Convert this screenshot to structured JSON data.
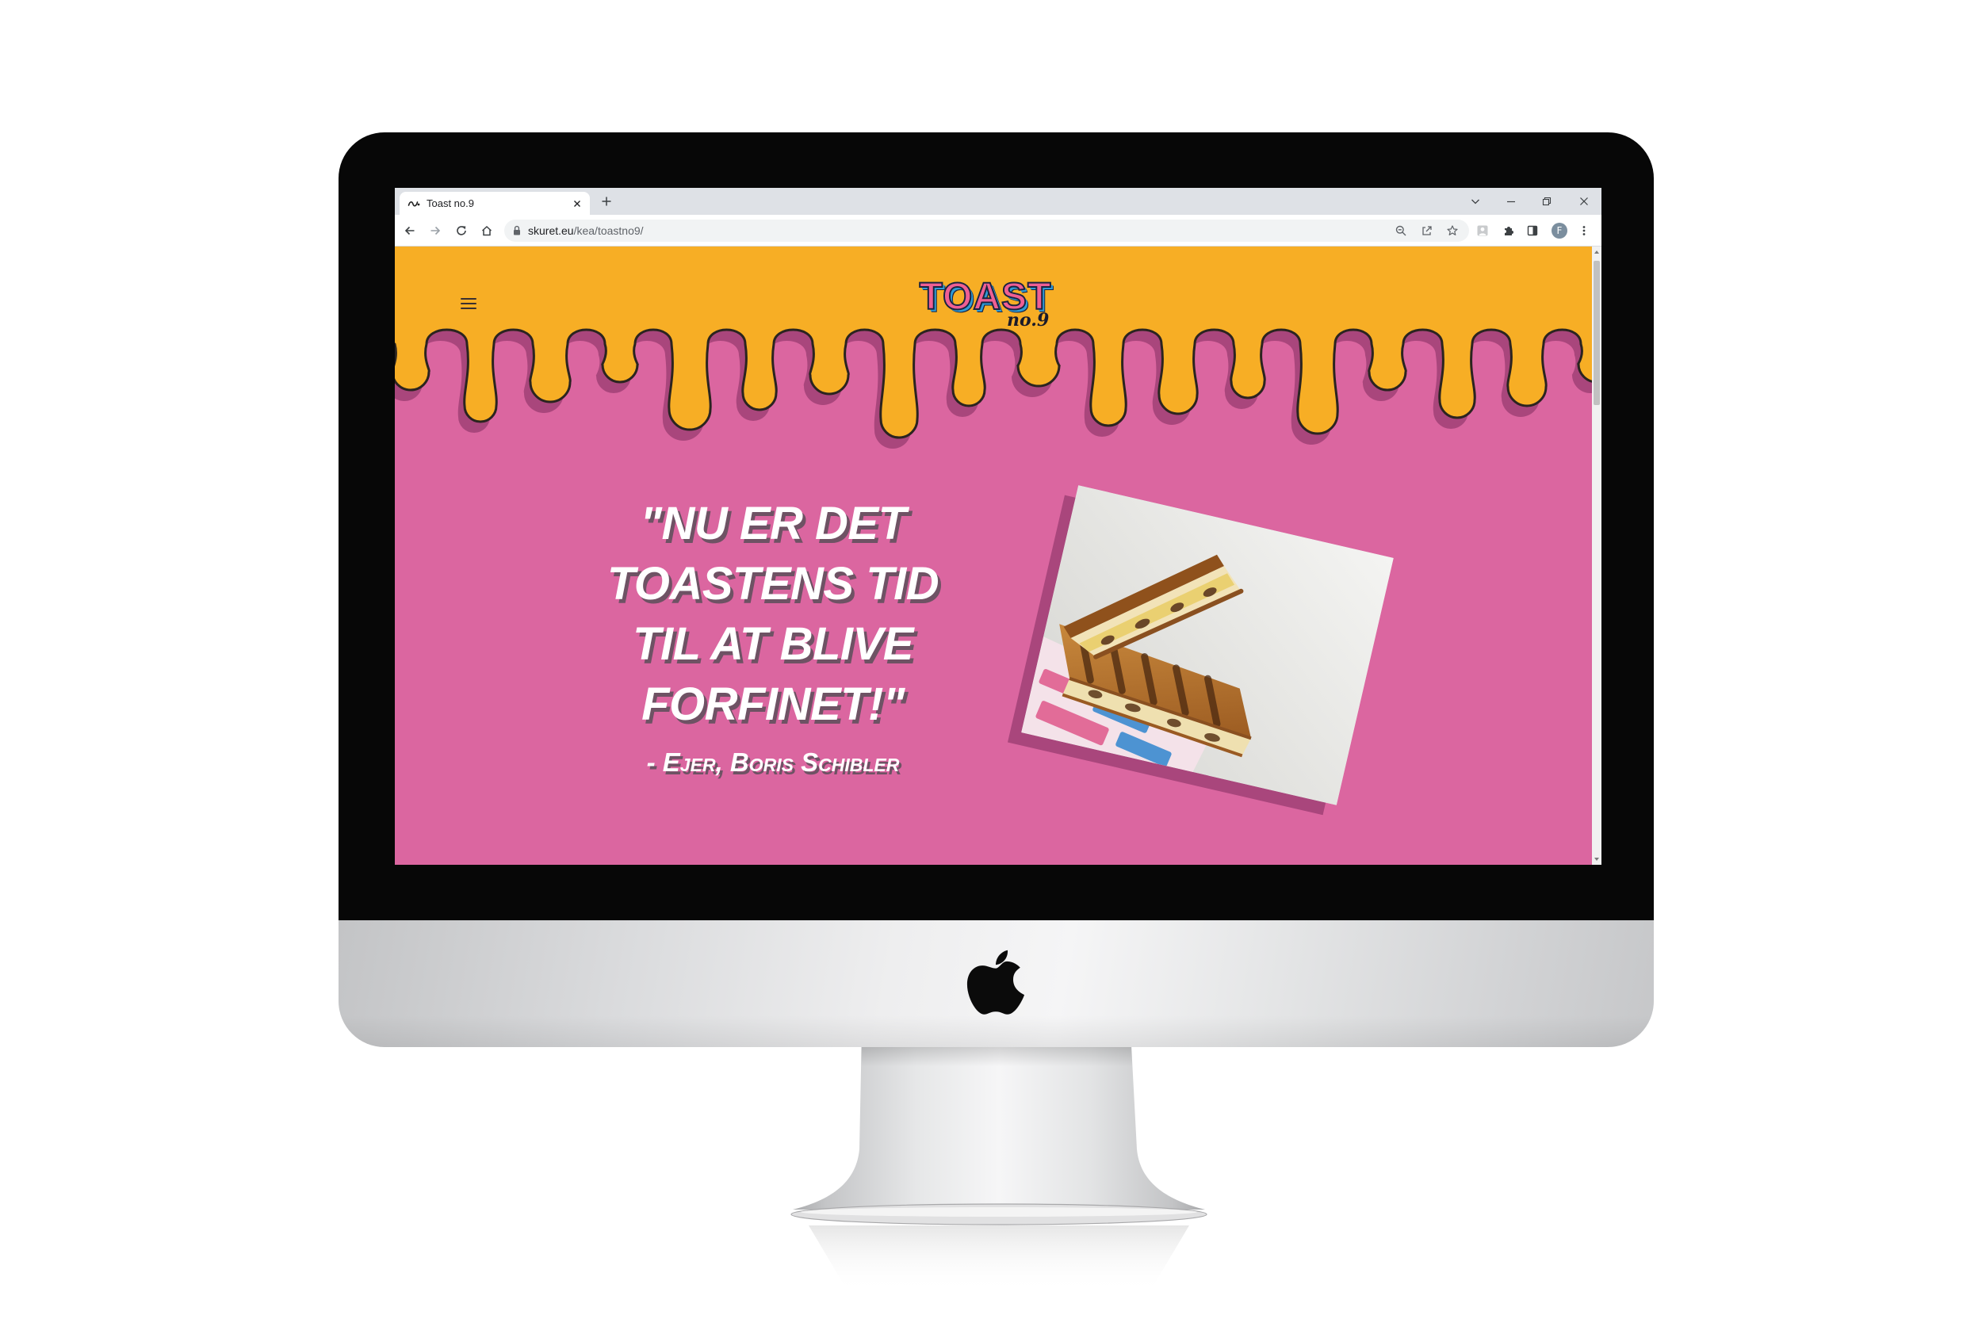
{
  "browser": {
    "tab": {
      "title": "Toast no.9",
      "favicon": "toast-favicon-icon",
      "close_icon": "close-icon"
    },
    "new_tab_icon": "plus-icon",
    "window_controls": [
      "chevron-down-icon",
      "minimize-icon",
      "restore-icon",
      "close-icon"
    ],
    "nav_icons": [
      "back-arrow-icon",
      "forward-arrow-icon",
      "reload-icon",
      "home-icon"
    ],
    "address": {
      "lock_icon": "lock-icon",
      "host": "skuret.eu",
      "path": "/kea/toastno9/"
    },
    "address_actions": [
      "zoom-icon",
      "share-icon",
      "star-icon"
    ],
    "extensions": [
      "profile-extension-icon",
      "puzzle-icon",
      "sidebar-icon"
    ],
    "profile_initial": "F",
    "menu_icon": "kebab-menu-icon"
  },
  "site": {
    "menu_icon": "hamburger-icon",
    "logo": {
      "text": "TOAST",
      "sub": "no.9"
    },
    "quote": {
      "lines": [
        "\"NU ER DET",
        "TOASTENS TID",
        "TIL AT BLIVE",
        "FORFINET!\""
      ],
      "attribution": "- Ejer, Boris Schibler"
    },
    "colors": {
      "header_yellow": "#f7ae25",
      "page_pink": "#db66a0",
      "drip_shadow": "#a9467c",
      "logo_pink": "#ef5f93",
      "logo_blue": "#2e9bd6"
    }
  },
  "device": {
    "logo_icon": "apple-logo-icon"
  }
}
